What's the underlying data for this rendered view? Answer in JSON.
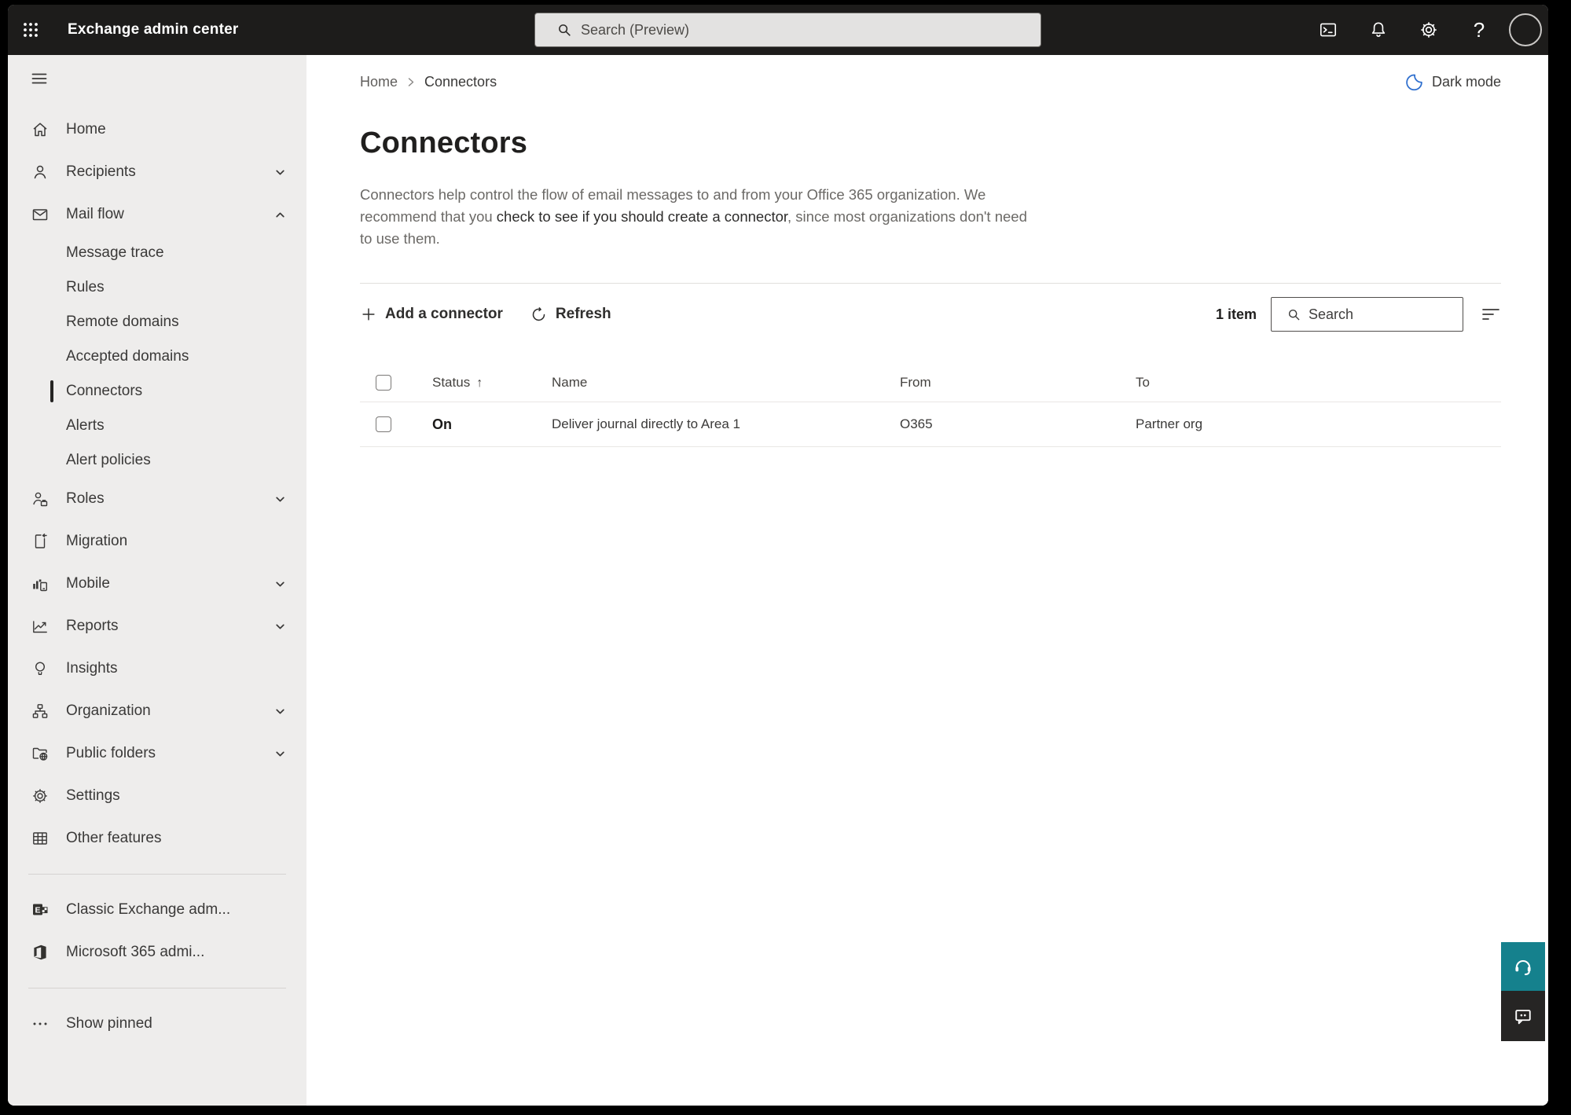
{
  "theme": {
    "accent_teal": "#15818d",
    "dark_mode_icon_blue": "#2f6fce",
    "topbar_bg": "#1d1c1b",
    "sidebar_bg": "#eeedec",
    "selected_marker": "#252423"
  },
  "topbar": {
    "app_title": "Exchange admin center",
    "search_placeholder": "Search (Preview)",
    "icons": [
      "app-launcher-icon",
      "terminal-icon",
      "bell-icon",
      "gear-icon",
      "help-icon",
      "avatar"
    ]
  },
  "sidebar": {
    "items": [
      {
        "label": "Home",
        "icon": "home-icon"
      },
      {
        "label": "Recipients",
        "icon": "person-icon",
        "chevron": "down"
      },
      {
        "label": "Mail flow",
        "icon": "mail-icon",
        "chevron": "up",
        "expanded": true
      },
      {
        "label": "Message trace",
        "sub": true
      },
      {
        "label": "Rules",
        "sub": true
      },
      {
        "label": "Remote domains",
        "sub": true
      },
      {
        "label": "Accepted domains",
        "sub": true
      },
      {
        "label": "Connectors",
        "sub": true,
        "selected": true
      },
      {
        "label": "Alerts",
        "sub": true
      },
      {
        "label": "Alert policies",
        "sub": true
      },
      {
        "label": "Roles",
        "icon": "roles-icon",
        "chevron": "down"
      },
      {
        "label": "Migration",
        "icon": "migration-icon"
      },
      {
        "label": "Mobile",
        "icon": "mobile-icon",
        "chevron": "down"
      },
      {
        "label": "Reports",
        "icon": "reports-icon",
        "chevron": "down"
      },
      {
        "label": "Insights",
        "icon": "lightbulb-icon"
      },
      {
        "label": "Organization",
        "icon": "org-chart-icon",
        "chevron": "down"
      },
      {
        "label": "Public folders",
        "icon": "folder-globe-icon",
        "chevron": "down"
      },
      {
        "label": "Settings",
        "icon": "gear-icon"
      },
      {
        "label": "Other features",
        "icon": "table-grid-icon"
      },
      {
        "label": "Classic Exchange adm...",
        "icon": "exchange-logo-icon"
      },
      {
        "label": "Microsoft 365 admi...",
        "icon": "m365-logo-icon"
      },
      {
        "label": "Show pinned",
        "icon": "ellipsis-icon"
      }
    ]
  },
  "page": {
    "breadcrumb": {
      "home": "Home",
      "current": "Connectors"
    },
    "dark_mode_label": "Dark mode",
    "title": "Connectors",
    "description": {
      "part1": "Connectors help control the flow of email messages to and from your Office 365 organization. We recommend that you ",
      "link": "check to see if you should create a connector",
      "part2": ", since most organizations don't need to use them."
    },
    "toolbar": {
      "add_label": "Add a connector",
      "refresh_label": "Refresh",
      "item_count": "1 item",
      "search_placeholder": "Search",
      "sort_arrow": "↑"
    },
    "table": {
      "headers": [
        "Status",
        "Name",
        "From",
        "To"
      ],
      "rows": [
        {
          "status": "On",
          "name": "Deliver journal directly to Area 1",
          "from": "O365",
          "to": "Partner org"
        }
      ]
    }
  }
}
